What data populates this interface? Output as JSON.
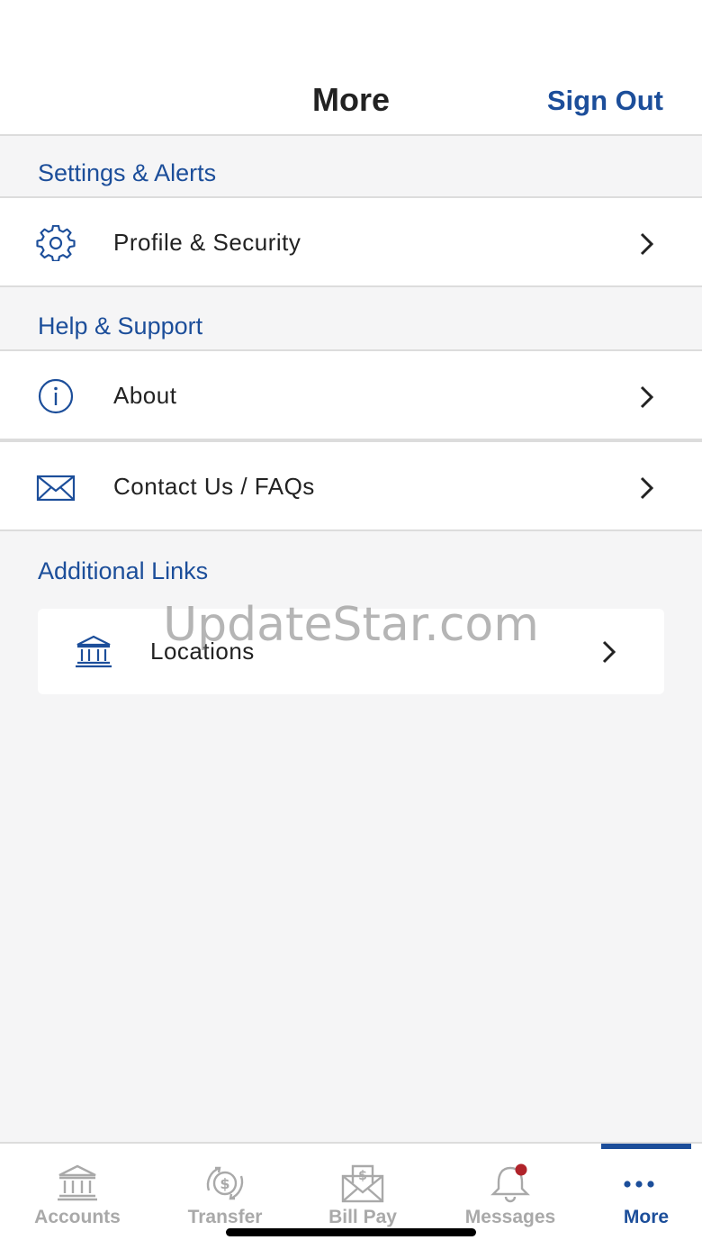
{
  "header": {
    "title": "More",
    "sign_out": "Sign Out"
  },
  "sections": {
    "settings": {
      "title": "Settings & Alerts",
      "items": [
        {
          "label": "Profile & Security",
          "icon": "gear-icon"
        }
      ]
    },
    "help": {
      "title": "Help & Support",
      "items": [
        {
          "label": "About",
          "icon": "info-icon"
        },
        {
          "label": "Contact Us / FAQs",
          "icon": "envelope-icon"
        }
      ]
    },
    "additional": {
      "title": "Additional Links",
      "items": [
        {
          "label": "Locations",
          "icon": "bank-icon"
        }
      ]
    }
  },
  "watermark": "UpdateStar.com",
  "tabs": [
    {
      "label": "Accounts",
      "icon": "bank-icon"
    },
    {
      "label": "Transfer",
      "icon": "transfer-icon"
    },
    {
      "label": "Bill Pay",
      "icon": "bill-pay-icon"
    },
    {
      "label": "Messages",
      "icon": "bell-icon"
    },
    {
      "label": "More",
      "icon": "more-dots-icon",
      "active": true
    }
  ],
  "colors": {
    "accent": "#1c4e9a",
    "inactive": "#a9a9a9",
    "badge": "#b0232a",
    "background": "#f5f5f6"
  }
}
